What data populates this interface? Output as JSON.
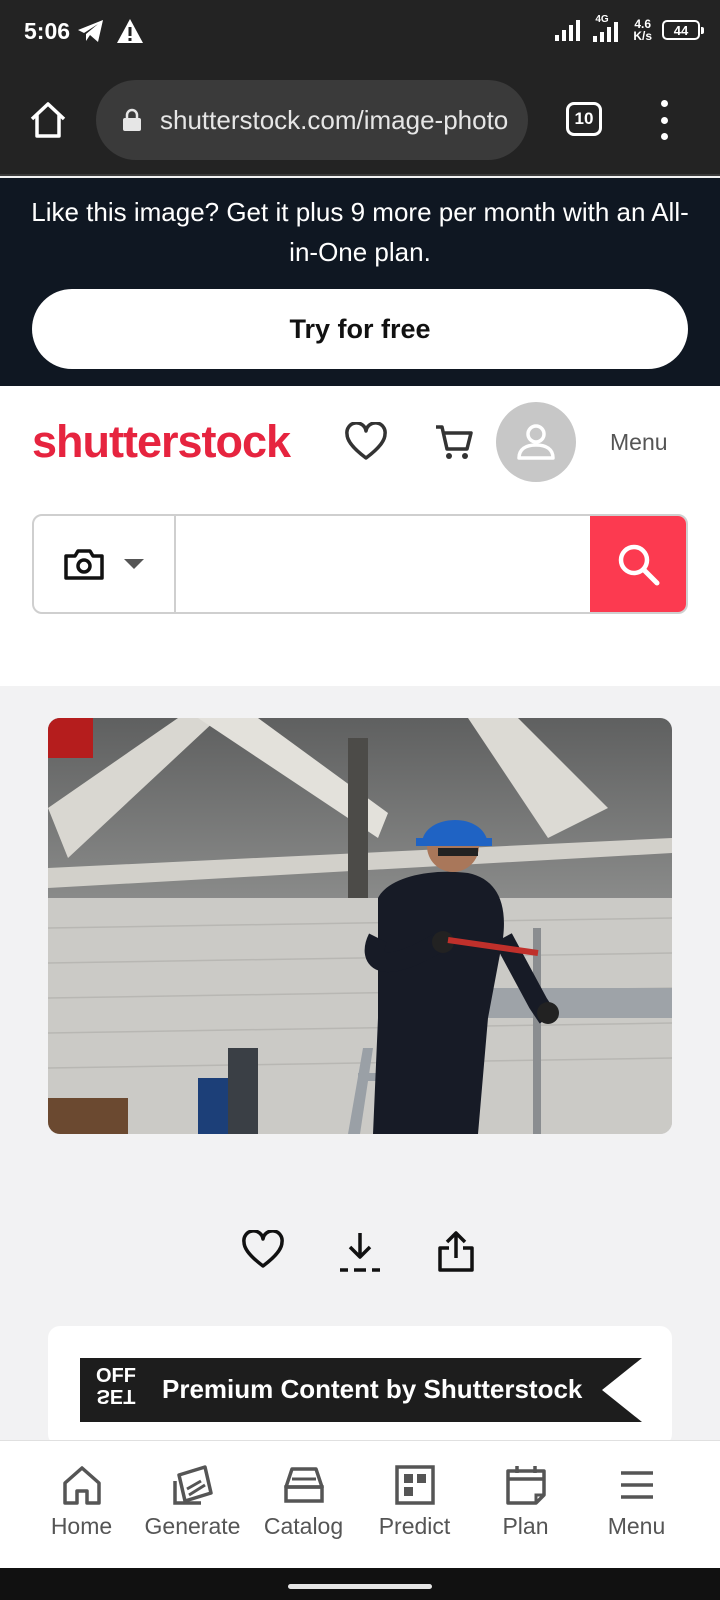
{
  "status_bar": {
    "time": "5:06",
    "network": "4G",
    "speed_value": "4.6",
    "speed_unit": "K/s",
    "battery": "44"
  },
  "browser": {
    "url": "shutterstock.com/image-photo",
    "tab_count": "10"
  },
  "promo": {
    "message": "Like this image? Get it plus 9 more per month with an All-in-One plan.",
    "cta": "Try for free"
  },
  "header": {
    "logo": "shutterstock",
    "menu_label": "Menu"
  },
  "search": {
    "placeholder": "",
    "value": ""
  },
  "offset": {
    "logo_top": "OFF",
    "logo_bottom": "SET",
    "title": "Premium Content by Shutterstock"
  },
  "bottom_nav": {
    "items": [
      {
        "label": "Home"
      },
      {
        "label": "Generate"
      },
      {
        "label": "Catalog"
      },
      {
        "label": "Predict"
      },
      {
        "label": "Plan"
      },
      {
        "label": "Menu"
      }
    ]
  },
  "colors": {
    "brand": "#e6243f",
    "search_button": "#fc3a50",
    "promo_bg": "#0f1722"
  }
}
